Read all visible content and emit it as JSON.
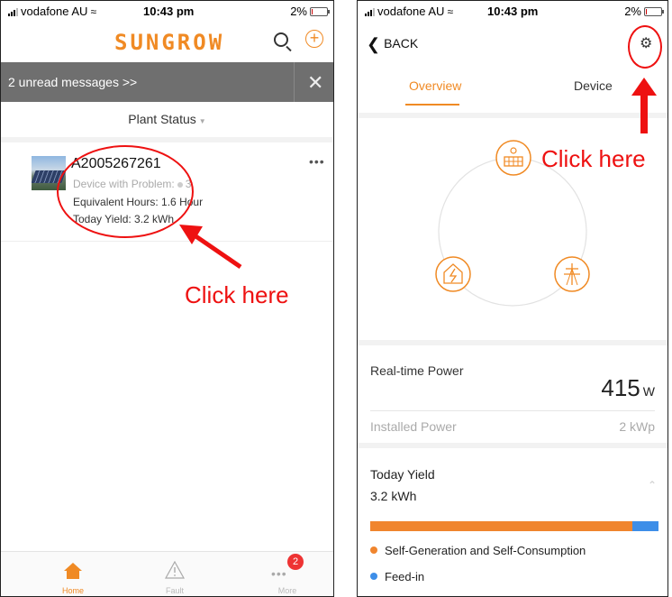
{
  "left": {
    "status": {
      "carrier": "vodafone AU",
      "time": "10:43 pm",
      "battery": "2%"
    },
    "header": {
      "brand": "SUNGROW"
    },
    "messages": {
      "text": "2 unread messages >>",
      "close": "✕"
    },
    "filter": {
      "label": "Plant Status"
    },
    "plant": {
      "name": "A2005267261",
      "device_problem_label": "Device with Problem:",
      "device_problem_count": "3",
      "equivalent_hours": "Equivalent Hours: 1.6 Hour",
      "today_yield": "Today Yield: 3.2 kWh",
      "menu": "•••"
    },
    "annotation": {
      "text": "Click here"
    },
    "tabbar": {
      "home": "Home",
      "fault": "Fault",
      "more": "More",
      "more_badge": "2"
    }
  },
  "right": {
    "status": {
      "carrier": "vodafone AU",
      "time": "10:43 pm",
      "battery": "2%"
    },
    "nav": {
      "back": "BACK"
    },
    "tabs": {
      "overview": "Overview",
      "device": "Device"
    },
    "annotation": {
      "text": "Click here"
    },
    "realtime": {
      "label": "Real-time Power",
      "value": "415",
      "unit": "W"
    },
    "installed": {
      "label": "Installed Power",
      "value": "2 kWp"
    },
    "today": {
      "label": "Today Yield",
      "value": "3.2  kWh",
      "self_fraction": 0.91
    },
    "legend": {
      "self": "Self-Generation and Self-Consumption",
      "feed": "Feed-in"
    },
    "colors": {
      "accent": "#f08a24",
      "self": "#f0852e",
      "feed": "#3d8ee8",
      "annotation": "#e11111"
    }
  }
}
